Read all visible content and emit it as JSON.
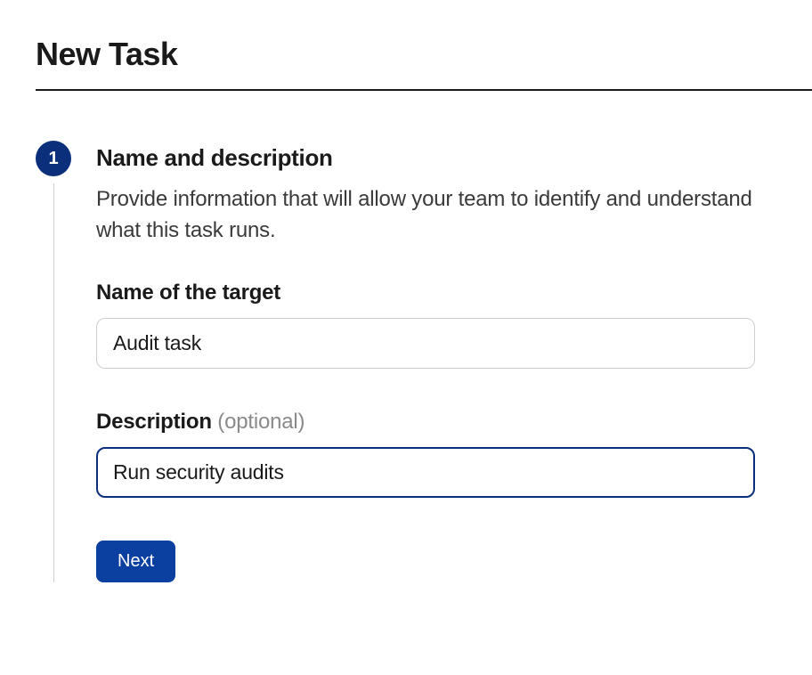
{
  "page": {
    "title": "New Task"
  },
  "step": {
    "number": "1",
    "title": "Name and description",
    "subtitle": "Provide information that will allow your team to identify and understand what this task runs."
  },
  "fields": {
    "name": {
      "label": "Name of the target",
      "value": "Audit task"
    },
    "description": {
      "label": "Description ",
      "optional": "(optional)",
      "value": "Run security audits"
    }
  },
  "actions": {
    "next": "Next"
  }
}
